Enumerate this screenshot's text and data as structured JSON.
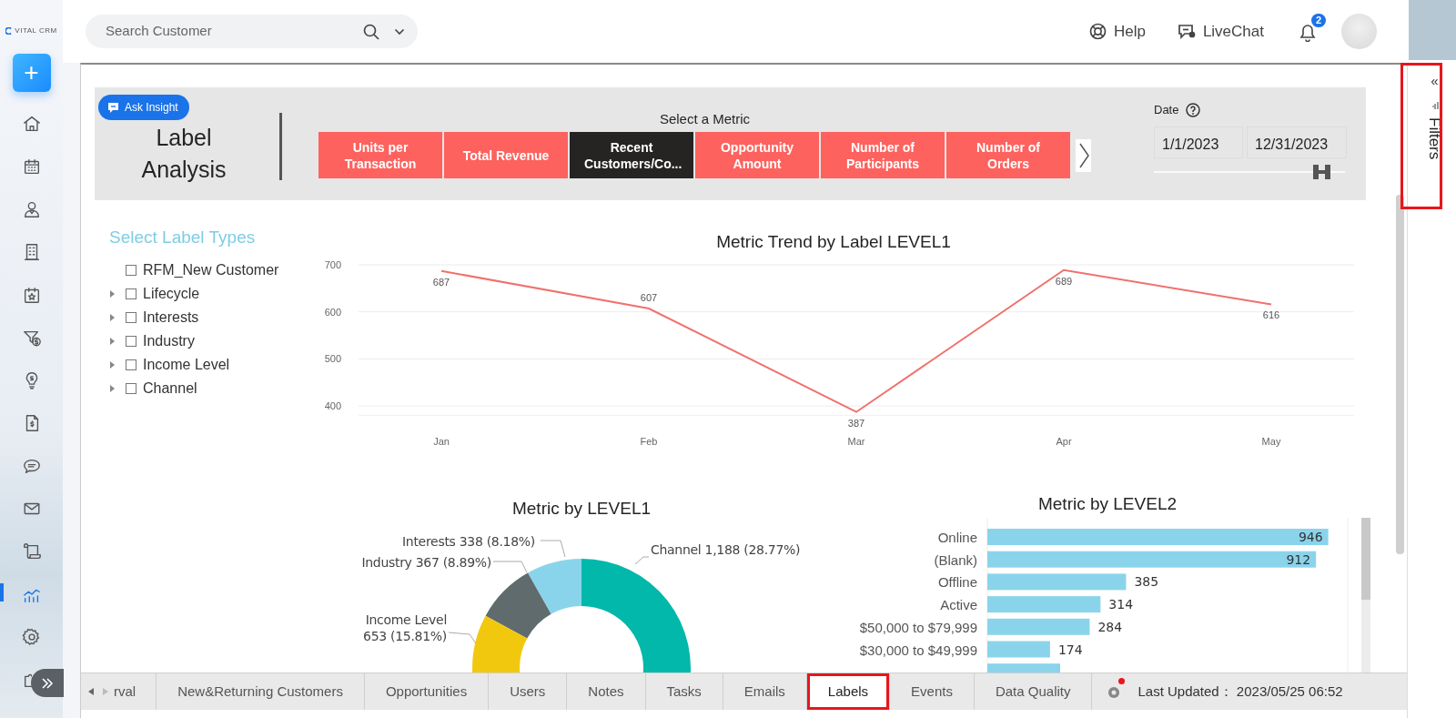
{
  "sidebar": {
    "logo": "VITAL CRM",
    "add_button": "+",
    "items": [
      {
        "selected": false
      },
      {
        "selected": false
      },
      {
        "selected": false
      },
      {
        "selected": false
      },
      {
        "selected": false
      },
      {
        "selected": false
      },
      {
        "selected": false
      },
      {
        "selected": false
      },
      {
        "selected": false
      },
      {
        "selected": false
      },
      {
        "selected": false
      },
      {
        "selected": true
      },
      {
        "selected": false
      },
      {
        "selected": false
      }
    ]
  },
  "header": {
    "search": {
      "placeholder": "Search Customer"
    },
    "help": "Help",
    "livechat": "LiveChat",
    "notifications": "2"
  },
  "report": {
    "ask_button": "Ask Insight",
    "title": "Label Analysis",
    "metric_label": "Select a Metric",
    "metrics": [
      {
        "label": "Units per Transaction",
        "selected": false
      },
      {
        "label": "Total Revenue",
        "selected": false
      },
      {
        "label": "Recent Customers/Co...",
        "selected": true
      },
      {
        "label": "Opportunity Amount",
        "selected": false
      },
      {
        "label": "Number of Participants",
        "selected": false
      },
      {
        "label": "Number of Orders",
        "selected": false
      }
    ],
    "date": {
      "label": "Date",
      "from": "1/1/2023",
      "to": "12/31/2023",
      "slider": {
        "level": 0.88
      }
    },
    "label_types": {
      "title": "Select Label Types",
      "items": [
        {
          "label": "RFM_New Customer",
          "kind": "leaf",
          "checked": false
        },
        {
          "label": "Lifecycle",
          "kind": "group",
          "expanded": false,
          "checked": false
        },
        {
          "label": "Interests",
          "kind": "group",
          "expanded": false,
          "checked": false
        },
        {
          "label": "Industry",
          "kind": "group",
          "expanded": false,
          "checked": false
        },
        {
          "label": "Income Level",
          "kind": "group",
          "expanded": false,
          "checked": false
        },
        {
          "label": "Channel",
          "kind": "group",
          "expanded": false,
          "checked": false
        }
      ]
    },
    "trend": {
      "chart_data": {
        "type": "line",
        "title": "Metric Trend by Label LEVEL1",
        "categories": [
          "Jan",
          "Feb",
          "Mar",
          "Apr",
          "May"
        ],
        "series": [
          {
            "color": "#f0716c",
            "values": [
              687,
              607,
              387,
              689,
              616
            ]
          }
        ],
        "ylim": [
          380,
          700
        ],
        "yticks": [
          400,
          500,
          600,
          700
        ],
        "grid": true,
        "data_labels": true
      }
    },
    "level1": {
      "chart_data": {
        "type": "donut",
        "title": "Metric by LEVEL1",
        "values": [
          1188,
          338,
          367,
          653
        ],
        "colors": [
          "#01b8aa",
          "#8ad4eb",
          "#5f6b6d",
          "#f2c80f"
        ],
        "value_labels": [
          "Channel 1,188 (28.77%)",
          "Interests 338 (8.18%)",
          "Industry 367 (8.89%)",
          "Income Level 653 (15.81%)"
        ]
      }
    },
    "level2": {
      "chart_data": {
        "type": "bar",
        "orientation": "horizontal",
        "title": "Metric by LEVEL2",
        "categories": [
          "Online",
          "(Blank)",
          "Offline",
          "Active",
          "$50,000 to $79,999",
          "$30,000 to $49,999"
        ],
        "series": [
          {
            "color": "#8ad4eb",
            "values": [
              946,
              912,
              385,
              314,
              284,
              174
            ]
          }
        ],
        "xlim": [
          0,
          1000
        ],
        "data_labels": true
      }
    }
  },
  "page_tabs": [
    {
      "label": "rval",
      "selected": false
    },
    {
      "label": "New&Returning Customers",
      "selected": false
    },
    {
      "label": "Opportunities",
      "selected": false
    },
    {
      "label": "Users",
      "selected": false
    },
    {
      "label": "Notes",
      "selected": false
    },
    {
      "label": "Tasks",
      "selected": false
    },
    {
      "label": "Emails",
      "selected": false
    },
    {
      "label": "Labels",
      "selected": true
    },
    {
      "label": "Events",
      "selected": false
    },
    {
      "label": "Data Quality",
      "selected": false
    }
  ],
  "status": {
    "last_updated": "Last Updated： 2023/05/25 06:52"
  },
  "filters_pane": {
    "collapse": "«",
    "title": "Filters"
  }
}
